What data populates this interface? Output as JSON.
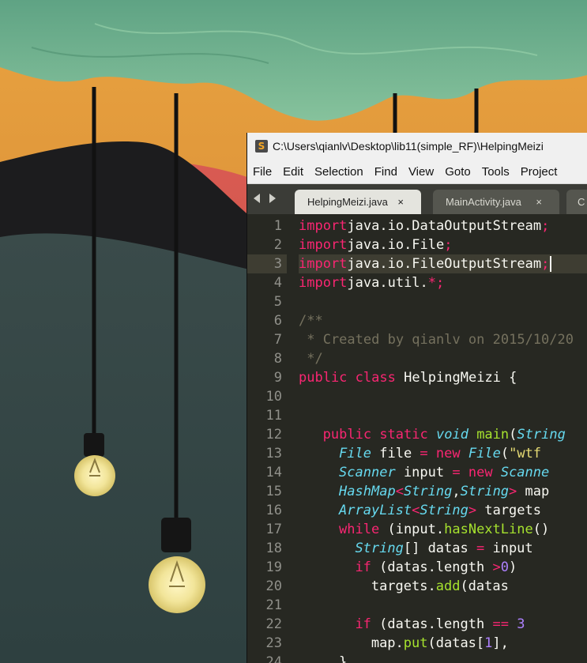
{
  "window": {
    "title": "C:\\Users\\qianlv\\Desktop\\lib11(simple_RF)\\HelpingMeizi",
    "app_icon_letter": "S"
  },
  "menu": [
    "File",
    "Edit",
    "Selection",
    "Find",
    "View",
    "Goto",
    "Tools",
    "Project"
  ],
  "tabs": [
    {
      "label": "HelpingMeizi.java",
      "active": true,
      "close": "×"
    },
    {
      "label": "MainActivity.java",
      "active": false,
      "close": "×"
    },
    {
      "label": "C",
      "active": false,
      "close": ""
    }
  ],
  "icons": {
    "nav_left": "triangle-left-icon",
    "nav_right": "triangle-right-icon",
    "tab_close": "close-icon"
  },
  "colors": {
    "editor_bg": "#272822",
    "keyword": "#f92672",
    "type": "#66d9ef",
    "function": "#a6e22e",
    "string": "#e6db74",
    "number": "#ae81ff",
    "comment": "#75715e"
  },
  "editor": {
    "active_line": 3,
    "lines": [
      {
        "n": "1",
        "t": [
          [
            "kw",
            "import"
          ],
          [
            "",
            "java.io.DataOutputStream"
          ],
          [
            "kw",
            ";"
          ]
        ]
      },
      {
        "n": "2",
        "t": [
          [
            "kw",
            "import"
          ],
          [
            "",
            "java.io.File"
          ],
          [
            "kw",
            ";"
          ]
        ]
      },
      {
        "n": "3",
        "t": [
          [
            "kw",
            "import"
          ],
          [
            "",
            "java.io.FileOutputStream"
          ],
          [
            "kw",
            ";"
          ]
        ]
      },
      {
        "n": "4",
        "t": [
          [
            "kw",
            "import"
          ],
          [
            "",
            "java.util."
          ],
          [
            "kw",
            "*"
          ],
          [
            "kw",
            ";"
          ]
        ]
      },
      {
        "n": "5",
        "t": []
      },
      {
        "n": "6",
        "t": [
          [
            "cm",
            "/**"
          ]
        ]
      },
      {
        "n": "7",
        "t": [
          [
            "cm",
            " * Created by qianlv on 2015/10/20"
          ]
        ]
      },
      {
        "n": "8",
        "t": [
          [
            "cm",
            " */"
          ]
        ]
      },
      {
        "n": "9",
        "t": [
          [
            "kw",
            "public"
          ],
          [
            "",
            " "
          ],
          [
            "kw",
            "class"
          ],
          [
            "",
            " HelpingMeizi {"
          ]
        ]
      },
      {
        "n": "10",
        "t": []
      },
      {
        "n": "11",
        "t": []
      },
      {
        "n": "12",
        "t": [
          [
            "",
            " "
          ],
          [
            "kw",
            "public"
          ],
          [
            "",
            " "
          ],
          [
            "kw",
            "static"
          ],
          [
            "",
            " "
          ],
          [
            "typ",
            "void"
          ],
          [
            "",
            " "
          ],
          [
            "fn",
            "main"
          ],
          [
            "",
            "("
          ],
          [
            "typ",
            "String"
          ]
        ]
      },
      {
        "n": "13",
        "t": [
          [
            "",
            " "
          ],
          [
            "typ",
            "File"
          ],
          [
            "",
            " file "
          ],
          [
            "kw",
            "="
          ],
          [
            "",
            " "
          ],
          [
            "kw",
            "new"
          ],
          [
            "",
            " "
          ],
          [
            "typ",
            "File"
          ],
          [
            "",
            "("
          ],
          [
            "str",
            "\"wtf"
          ]
        ]
      },
      {
        "n": "14",
        "t": [
          [
            "",
            " "
          ],
          [
            "typ",
            "Scanner"
          ],
          [
            "",
            " input "
          ],
          [
            "kw",
            "="
          ],
          [
            "",
            " "
          ],
          [
            "kw",
            "new"
          ],
          [
            "",
            " "
          ],
          [
            "typ",
            "Scanne"
          ]
        ]
      },
      {
        "n": "15",
        "t": [
          [
            "",
            " "
          ],
          [
            "typ",
            "HashMap"
          ],
          [
            "kw",
            "<"
          ],
          [
            "typ",
            "String"
          ],
          [
            "",
            ","
          ],
          [
            "typ",
            "String"
          ],
          [
            "kw",
            ">"
          ],
          [
            "",
            " map"
          ]
        ]
      },
      {
        "n": "16",
        "t": [
          [
            "",
            " "
          ],
          [
            "typ",
            "ArrayList"
          ],
          [
            "kw",
            "<"
          ],
          [
            "typ",
            "String"
          ],
          [
            "kw",
            ">"
          ],
          [
            "",
            " targets"
          ]
        ]
      },
      {
        "n": "17",
        "t": [
          [
            "",
            " "
          ],
          [
            "kw",
            "while"
          ],
          [
            "",
            " (input."
          ],
          [
            "fn",
            "hasNextLine"
          ],
          [
            "",
            "()"
          ]
        ]
      },
      {
        "n": "18",
        "t": [
          [
            "",
            " "
          ],
          [
            "typ",
            "String"
          ],
          [
            "",
            "[] datas "
          ],
          [
            "kw",
            "="
          ],
          [
            "",
            " input"
          ]
        ]
      },
      {
        "n": "19",
        "t": [
          [
            "",
            " "
          ],
          [
            "kw",
            "if"
          ],
          [
            "",
            " (datas.length "
          ],
          [
            "kw",
            ">"
          ],
          [
            "num",
            "0"
          ],
          [
            "",
            ")"
          ]
        ]
      },
      {
        "n": "20",
        "t": [
          [
            "",
            " targets."
          ],
          [
            "fn",
            "add"
          ],
          [
            "",
            "(datas"
          ]
        ]
      },
      {
        "n": "21",
        "t": []
      },
      {
        "n": "22",
        "t": [
          [
            "",
            " "
          ],
          [
            "kw",
            "if"
          ],
          [
            "",
            " (datas.length "
          ],
          [
            "kw",
            "=="
          ],
          [
            "",
            " "
          ],
          [
            "num",
            "3"
          ]
        ]
      },
      {
        "n": "23",
        "t": [
          [
            "",
            " map."
          ],
          [
            "fn",
            "put"
          ],
          [
            "",
            "(datas["
          ],
          [
            "num",
            "1"
          ],
          [
            "",
            "],"
          ]
        ]
      },
      {
        "n": "24",
        "t": [
          [
            "",
            " }"
          ]
        ]
      }
    ]
  }
}
